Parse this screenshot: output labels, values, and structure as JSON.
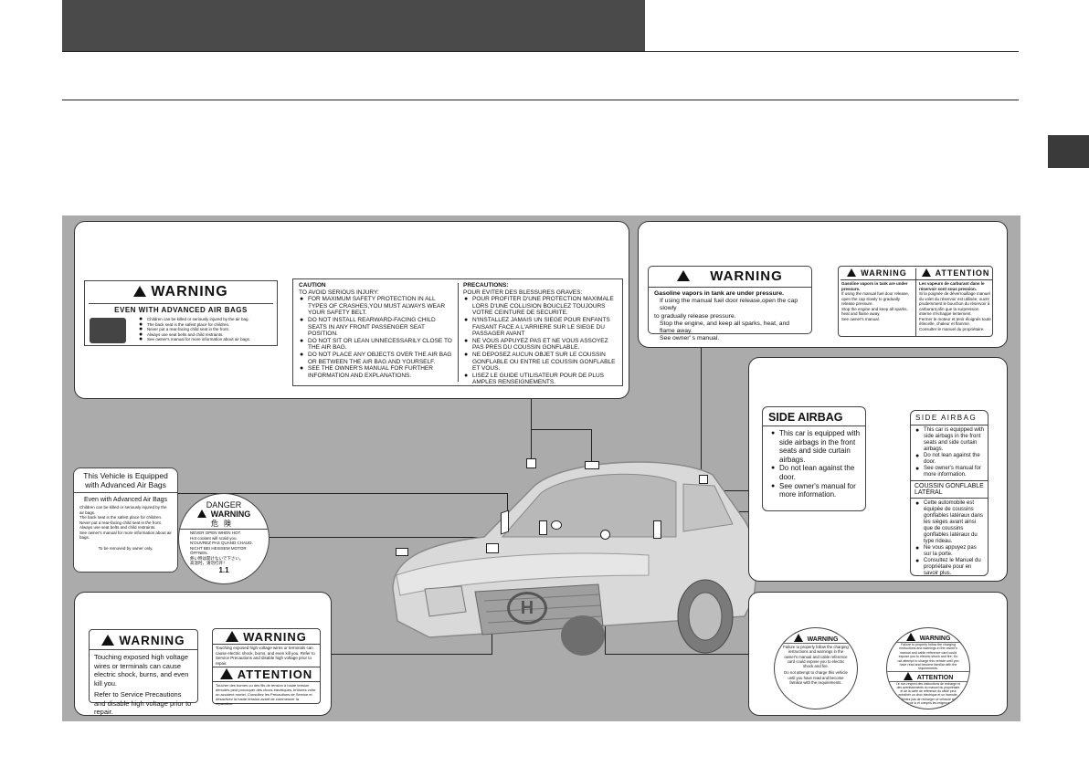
{
  "airbag_warning_label": {
    "title": "WARNING",
    "headline": "EVEN WITH ADVANCED AIR BAGS",
    "bullets": [
      "Children can be killed or seriously injured by the air bag.",
      "The back seat is the safest place for children.",
      "Never put a rear-facing child seat in the front.",
      "Always use seat belts and child restraints.",
      "See owner's manual for more information about air bags."
    ]
  },
  "caution_label": {
    "en_title": "CAUTION",
    "en_lines": [
      "TO AVOID SERIOUS INJURY:",
      "FOR MAXIMUM SAFETY PROTECTION IN ALL TYPES OF CRASHES,YOU MUST ALWAYS WEAR YOUR SAFETY BELT.",
      "DO NOT INSTALL REARWARD-FACING CHILD SEATS IN ANY FRONT PASSENGER SEAT POSITION.",
      "DO NOT SIT OR LEAN UNNECESSARILY CLOSE TO THE AIR BAG.",
      "DO NOT PLACE ANY OBJECTS OVER THE AIR BAG OR BETWEEN THE AIR BAG AND YOURSELF.",
      "SEE THE OWNER'S MANUAL FOR FURTHER INFORMATION AND EXPLANATIONS."
    ],
    "fr_title": "PRECAUTIONS:",
    "fr_lines": [
      "POUR EVITER DES BLESSURES GRAVES:",
      "POUR PROFITER D'UNE PROTECTION MAXIMALE LORS D'UNE COLLISION BOUCLEZ TOUJOURS VOTRE CEINTURE DE SECURITE.",
      "N'INSTALLEZ JAMAIS UN SIEGE POUR ENFANTS FAISANT FACE A L'ARRIERE SUR LE SIEGE DU PASSAGER AVANT",
      "NE VOUS APPUYEZ PAS ET NE VOUS ASSOYEZ PAS PRES DU COUSSIN GONFLABLE.",
      "NE DEPOSEZ AUCUN OBJET SUR LE COUSSIN GONFLABLE OU ENTRE LE COUSSIN GONFLABLE ET VOUS.",
      "LISEZ LE GUIDE UTILISATEUR POUR DE PLUS AMPLES RENSEIGNEMENTS."
    ]
  },
  "fuel_warning_label": {
    "title": "WARNING",
    "headline": "Gasoline vapors in tank are under pressure.",
    "lines": [
      "If using the manual fuel door release,open the cap slowly",
      "to gradually release pressure.",
      "Stop the engine, and keep all sparks, heat, and flame away.",
      "See owner' s manual."
    ]
  },
  "fuel_bilingual_label": {
    "title_en": "WARNING",
    "title_fr": "ATTENTION",
    "en_lines": [
      "Gasoline vapors in tank are under pressure.",
      "If using the manual fuel door release, open the cap slowly to gradually release pressure.",
      "Stop the engine and keep all sparks, heat and flame away.",
      "See owner's manual."
    ],
    "fr_lines": [
      "Les vapeurs de carburant dans le réservoir sont sous pression.",
      "Si la poignée de déverrouillage manuel du volet du réservoir est utilisée, ouvrir prudemment le bouchon du réservoir à carburant,afin que la surpression interne s'échappe lentement.",
      "Fermer le moteur et tenir éloignés toute étincelle, chaleur et flamme.",
      "Consulter le manuel du propriétaire."
    ]
  },
  "side_airbag_label": {
    "title": "SIDE AIRBAG",
    "bullets": [
      "This car is equipped with side airbags in the front seats and side curtain airbags.",
      "Do not lean against the door.",
      "See owner's manual for more information."
    ]
  },
  "side_airbag_bilingual_label": {
    "title_en": "SIDE AIRBAG",
    "bullets_en": [
      "This car is equipped with side airbags in the front seats and side curtain airbags.",
      "Do not lean against the door.",
      "See owner's manual for more information."
    ],
    "title_fr": "COUSSIN GONFLABLE LATÉRAL",
    "bullets_fr": [
      "Cette automobile est équipée de coussins gonflables latéraux dans les sièges avant ainsi que de coussins gonflables latéraux du type rideau.",
      "Ne vous appuyez pas sur la porte.",
      "Consultez le Manuel du propriétaire pour en savoir plus."
    ]
  },
  "visor_label": {
    "title": "This Vehicle is Equipped with Advanced Air Bags",
    "subtitle": "Even with Advanced Air Bags",
    "lines": [
      "Children can be killed or seriously injured by the air bags.",
      "The back seat is the safest place for children.",
      "Never put a rear-facing child seat in the front.",
      "Always use seat belts and child restraints.",
      "See owner's manual for more information about air bags."
    ],
    "footer": "To be removed by owner only."
  },
  "radiator_cap_label": {
    "title_en": "DANGER",
    "title_warning": "WARNING",
    "title_jp": "危険",
    "lines": [
      "NEVER OPEN WHEN HOT.",
      "Hot coolant will scald you.",
      "N'OUVREZ PAS QUAND CHAUD.",
      "NICHT BEI HEISSEM MOTOR ÖFFNEN.",
      "熱い時は開けないで下さい。",
      "高温时，请勿打开！"
    ],
    "footer": "1.1"
  },
  "hv_warning_label": {
    "title": "WARNING",
    "lines": [
      "Touching exposed high voltage wires or terminals can cause electric shock, burns, and even kill you.",
      "Refer to Service Precautions and disable high voltage prior to repair."
    ]
  },
  "hv_bilingual_label": {
    "title_en": "WARNING",
    "en_text": "Touching exposed high voltage wires or terminals can cause electric shock, burns, and even kill you. Refer to Service Precautions and disable high voltage prior to repair.",
    "title_fr": "ATTENTION",
    "fr_text": "Toucher des bornes ou des fils de tension à haute tension dénudés peut provoquer des chocs électriques, brûlures voire un accident mortel. Consultez les Précautions de Service et désactivez la haute tension avant de commencer la réparation."
  },
  "charge_label": {
    "title": "WARNING",
    "lines": [
      "Failure to properly follow the charging instructions and warnings in the owner's manual and cable reference card could expose you to electric shock and fire.",
      "Do not attempt to charge this vehicle until you have read and become familiar with the requirements."
    ]
  },
  "charge_bilingual_label": {
    "title_en": "WARNING",
    "en_text": "Failure to properly follow the charging instructions and warnings in the owner's manual and cable reference card could expose you to electric shock and fire. Do not attempt to charge this vehicle until you have read and become familiar with the requirements.",
    "title_fr": "ATTENTION",
    "fr_text": "Le non-respect des instructions de recharge et des avertissements du manuel du propriétaire et de la carte de référence du câble peut entraîner un choc électrique et un incendie. Ne tentez pas de recharger ce véhicule avant d'avoir lu et compris les exigences."
  },
  "car_badge": "H"
}
